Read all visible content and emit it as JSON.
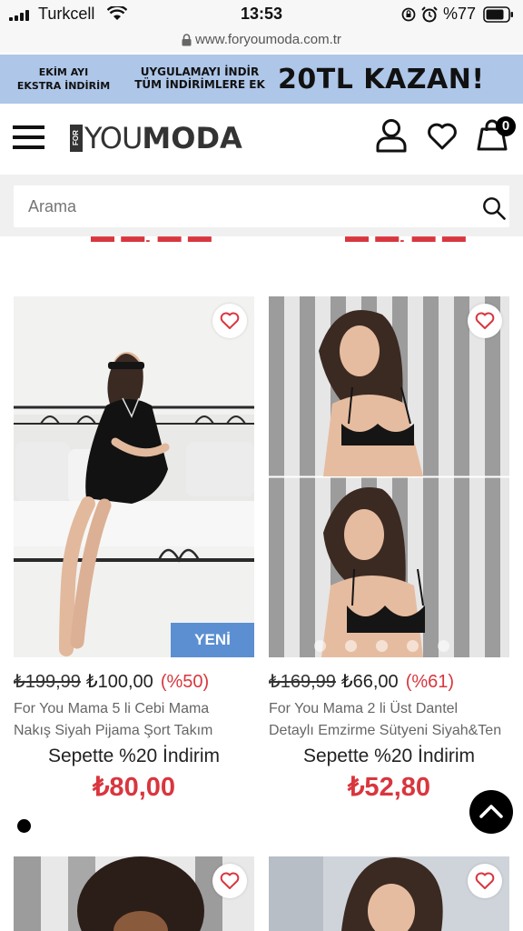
{
  "status_bar": {
    "carrier": "Turkcell",
    "time": "13:53",
    "battery": "%77"
  },
  "url_bar": {
    "url": "www.foryoumoda.com.tr"
  },
  "promo": {
    "left_line1": "EKİM AYI",
    "left_line2": "EKSTRA İNDİRİM",
    "mid_line1": "UYGULAMAYI İNDİR",
    "mid_line2": "TÜM İNDİRİMLERE EK",
    "big": "20TL KAZAN!"
  },
  "header": {
    "logo_for": "FOR",
    "logo_you": "YOU",
    "logo_moda": "MODA",
    "cart_count": "0"
  },
  "search": {
    "placeholder": "Arama"
  },
  "products": [
    {
      "old_price": "₺199,99",
      "new_price": "₺100,00",
      "discount": "(%50)",
      "name_line1": "For You Mama 5 li Cebi Mama",
      "name_line2": "Nakış Siyah Pijama Şort Takım",
      "cart_discount": "Sepette %20 İndirim",
      "final_price": "₺80,00",
      "badge": "YENİ"
    },
    {
      "old_price": "₺169,99",
      "new_price": "₺66,00",
      "discount": "(%61)",
      "name_line1": "For You Mama 2 li Üst Dantel",
      "name_line2": "Detaylı Emzirme Sütyeni Siyah&Ten",
      "cart_discount": "Sepette %20 İndirim",
      "final_price": "₺52,80",
      "badge": ""
    }
  ],
  "colors": {
    "promo_bg": "#aec6e8",
    "price_red": "#d9363e",
    "badge_blue": "#5b8fd1"
  }
}
